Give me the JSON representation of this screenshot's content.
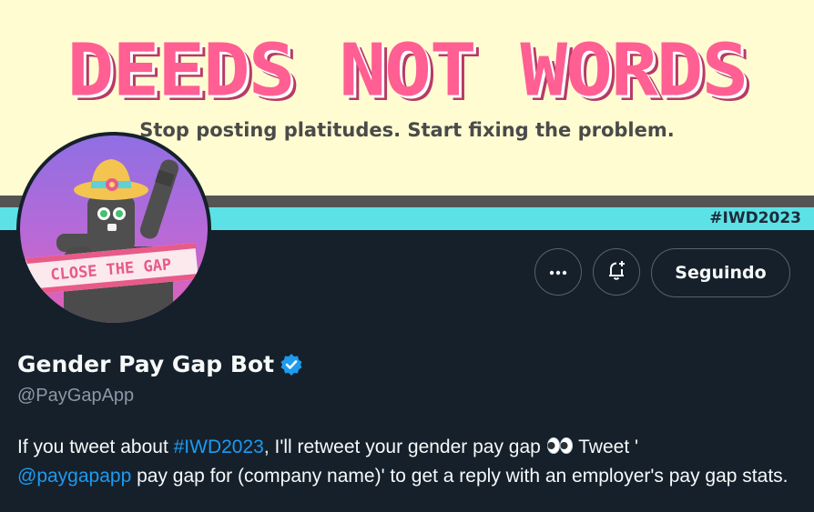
{
  "banner": {
    "headline": "DEEDS NOT WORDS",
    "subtitle": "Stop posting platitudes. Start fixing the problem.",
    "tag": "#IWD2023"
  },
  "avatar": {
    "sign_text": "CLOSE THE GAP"
  },
  "actions": {
    "more_icon": "more-dots-icon",
    "notify_icon": "bell-plus-icon",
    "follow_label": "Seguindo"
  },
  "profile": {
    "display_name": "Gender Pay Gap Bot",
    "verified_icon": "verified-badge-icon",
    "handle": "@PayGapApp",
    "bio": {
      "part1": "If you tweet about ",
      "hashtag": "#IWD2023",
      "part2": ", I'll retweet your gender pay gap ",
      "emoji": "eyes-emoji",
      "part3": " Tweet '",
      "mention": "@paygapapp",
      "part4": " pay gap for (company name)' to get a reply with an employer's pay gap stats."
    }
  },
  "colors": {
    "background": "#15202b",
    "banner_bg": "#fffcd1",
    "headline": "#ff5f93",
    "stripe_cyan": "#5ce2e6",
    "link": "#1d9bf0",
    "muted": "#8b98a5"
  }
}
